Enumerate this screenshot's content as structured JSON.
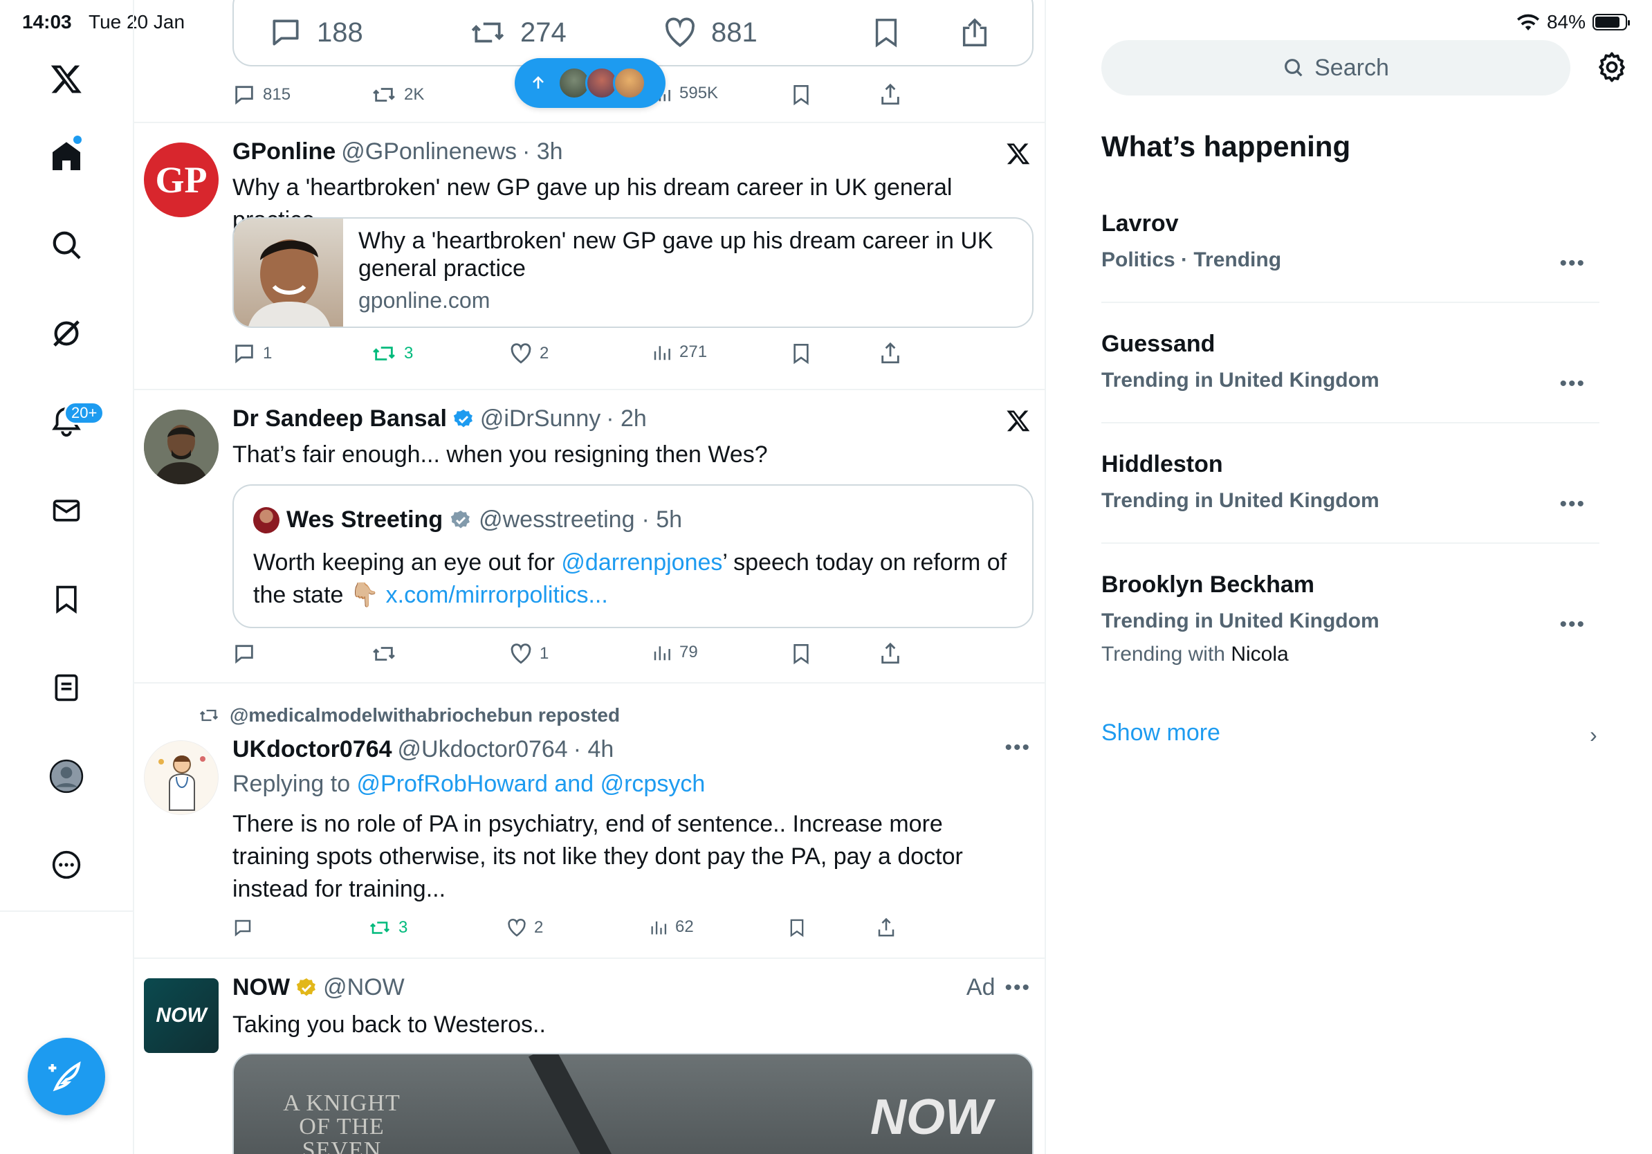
{
  "status_bar": {
    "time": "14:03",
    "date": "Tue 20 Jan",
    "battery": "84%",
    "battery_level": 0.84
  },
  "nav": {
    "notifications_badge": "20+"
  },
  "top_tweet": {
    "card_stats": {
      "replies": "188",
      "reposts": "274",
      "likes": "881"
    },
    "actions": {
      "replies": "815",
      "reposts": "2K",
      "views": "595K"
    }
  },
  "new_posts_pill": {
    "icon": "arrow-up-icon"
  },
  "tweets": [
    {
      "name": "GPonline",
      "handle": "@GPonlinenews",
      "time": "· 3h",
      "text": "Why a 'heartbroken' new GP gave up his dream career in UK general practice",
      "card": {
        "title": "Why a 'heartbroken' new GP gave up his dream career in UK general practice",
        "domain": "gponline.com"
      },
      "actions": {
        "replies": "1",
        "reposts": "3",
        "likes": "2",
        "views": "271"
      }
    },
    {
      "name": "Dr Sandeep Bansal",
      "handle": "@iDrSunny",
      "time": "· 2h",
      "text": "That’s fair enough... when you resigning then Wes?",
      "quote": {
        "name": "Wes Streeting",
        "handle": "@wesstreeting",
        "time": "· 5h",
        "text_before": "Worth keeping an eye out for ",
        "mention": "@darrenpjones",
        "text_after": "’ speech today on reform of the state 👇🏼 ",
        "link": "x.com/mirrorpolitics..."
      },
      "actions": {
        "likes": "1",
        "views": "79"
      }
    },
    {
      "reposted_by": "@medicalmodelwithabriochebun reposted",
      "name": "UKdoctor0764",
      "handle": "@Ukdoctor0764",
      "time": "· 4h",
      "replying_prefix": "Replying to ",
      "replying_to": "@ProfRobHoward and @rcpsych",
      "text": "There is no role of PA in psychiatry,  end of sentence..  Increase more training spots otherwise,  its not like they dont pay the PA,  pay a doctor instead for training...",
      "actions": {
        "reposts": "3",
        "likes": "2",
        "views": "62"
      }
    },
    {
      "name": "NOW",
      "handle": "@NOW",
      "ad_label": "Ad",
      "avatar_text": "NOW",
      "text": "Taking you back to Westeros..",
      "media": {
        "overlay_title": "A KNIGHT OF THE SEVEN KINGDOMS",
        "brand": "NOW"
      }
    }
  ],
  "sidebar": {
    "search_placeholder": "Search",
    "whats_happening": "What’s happening",
    "trends": [
      {
        "title": "Lavrov",
        "context": "Politics · Trending"
      },
      {
        "title": "Guessand",
        "context": "Trending in United Kingdom"
      },
      {
        "title": "Hiddleston",
        "context": "Trending in United Kingdom"
      },
      {
        "title": "Brooklyn Beckham",
        "context": "Trending in United Kingdom",
        "with_prefix": "Trending with ",
        "with_name": "Nicola"
      }
    ],
    "show_more": "Show more"
  },
  "colors": {
    "accent": "#1d9bf0",
    "repost_green": "#00ba7c",
    "secondary_text": "#536471",
    "gp_red": "#d8262d",
    "now_teal": "#0b4a4f"
  }
}
